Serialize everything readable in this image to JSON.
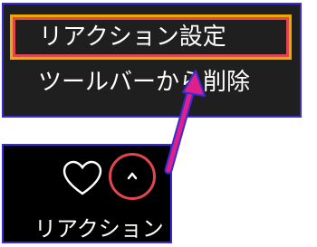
{
  "context_menu": {
    "items": [
      {
        "label": "リアクション設定",
        "highlighted": true
      },
      {
        "label": "ツールバーから削除",
        "highlighted": false
      }
    ]
  },
  "toolbar": {
    "heart_icon": "heart-outline-icon",
    "chevron_icon": "chevron-up-icon",
    "button_label": "リアクション"
  },
  "annotation": {
    "arrow_color": "#e0208a",
    "highlight_color": "#e0464e",
    "highlight_outline_color": "#f0a800",
    "panel_border_color": "#3a2bd6"
  }
}
